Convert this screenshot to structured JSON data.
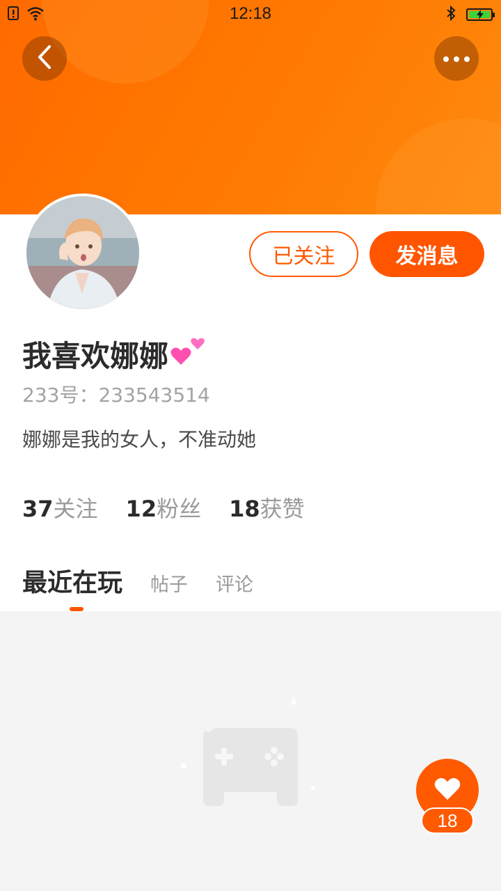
{
  "status_bar": {
    "time": "12:18",
    "icons": [
      "alert-icon",
      "wifi-icon",
      "bluetooth-icon",
      "battery-charging-icon"
    ],
    "battery_color": "#3bd23b"
  },
  "header": {
    "back_icon": "chevron-left-icon",
    "more_icon": "more-dots-icon",
    "banner_color": "#ff7a00"
  },
  "profile": {
    "nickname": "我喜欢娜娜",
    "nickname_emoji": "two-hearts-icon",
    "uid": "233号：233543514",
    "bio": "娜娜是我的女人，不准动她",
    "follow_button_label": "已关注",
    "message_button_label": "发消息"
  },
  "stats": [
    {
      "value": "37",
      "label": "关注"
    },
    {
      "value": "12",
      "label": "粉丝"
    },
    {
      "value": "18",
      "label": "获赞"
    }
  ],
  "tabs": [
    {
      "label": "最近在玩",
      "active": true
    },
    {
      "label": "帖子",
      "active": false
    },
    {
      "label": "评论",
      "active": false
    }
  ],
  "empty_state": {
    "icon": "gamepad-icon"
  },
  "like_fab": {
    "icon": "heart-icon",
    "count": "18"
  },
  "accent_color": "#ff5500"
}
